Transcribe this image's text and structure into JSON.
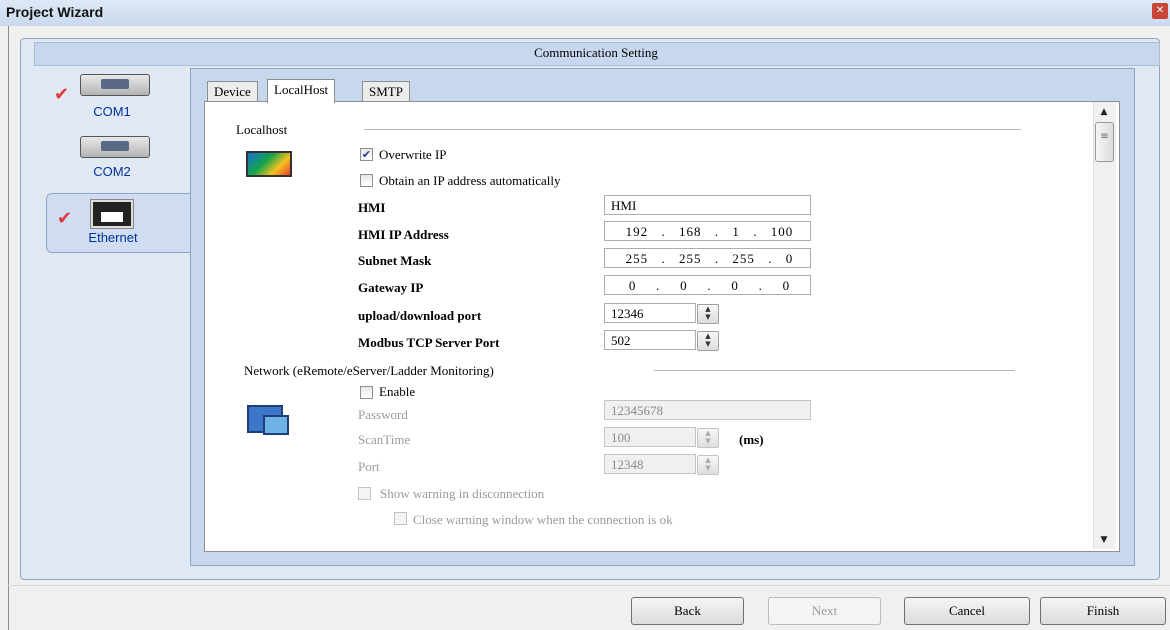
{
  "window": {
    "title": "Project Wizard",
    "close_glyph": "✕"
  },
  "dialog": {
    "header": "Communication Setting"
  },
  "nav": {
    "items": [
      {
        "label": "COM1",
        "checked": true,
        "selected": false,
        "icon": "serial-port-icon"
      },
      {
        "label": "COM2",
        "checked": false,
        "selected": false,
        "icon": "serial-port-icon"
      },
      {
        "label": "Ethernet",
        "checked": true,
        "selected": true,
        "icon": "ethernet-port-icon"
      }
    ],
    "check_glyph": "✔"
  },
  "tabs": [
    {
      "label": "Device",
      "active": false
    },
    {
      "label": "LocalHost",
      "active": true
    },
    {
      "label": "SMTP",
      "active": false
    }
  ],
  "localhost": {
    "section_title": "Localhost",
    "overwrite_ip": {
      "label": "Overwrite IP",
      "checked": true
    },
    "obtain_auto": {
      "label": "Obtain an IP address automatically",
      "checked": false
    },
    "hmi": {
      "label": "HMI",
      "value": "HMI"
    },
    "hmi_ip": {
      "label": "HMI IP Address",
      "octets": [
        "192",
        "168",
        "1",
        "100"
      ]
    },
    "subnet": {
      "label": "Subnet Mask",
      "octets": [
        "255",
        "255",
        "255",
        "0"
      ]
    },
    "gateway": {
      "label": "Gateway IP",
      "octets": [
        "0",
        "0",
        "0",
        "0"
      ]
    },
    "upload_port": {
      "label": "upload/download port",
      "value": "12346"
    },
    "modbus_port": {
      "label": "Modbus TCP Server Port",
      "value": "502"
    }
  },
  "network": {
    "section_title": "Network (eRemote/eServer/Ladder Monitoring)",
    "enable": {
      "label": "Enable",
      "checked": false
    },
    "password": {
      "label": "Password",
      "value": "12345678"
    },
    "scantime": {
      "label": "ScanTime",
      "value": "100",
      "unit": "(ms)"
    },
    "port": {
      "label": "Port",
      "value": "12348"
    },
    "show_warning": {
      "label": "Show warning in disconnection",
      "checked": false
    },
    "close_warning": {
      "label": "Close warning window when the connection is ok",
      "checked": false
    }
  },
  "ip_dot": ".",
  "glyphs": {
    "check": "✔",
    "up": "▲",
    "down": "▼",
    "spin": "▲\n▼",
    "grip": "≡"
  },
  "buttons": {
    "back": "Back",
    "next": "Next",
    "cancel": "Cancel",
    "finish": "Finish"
  },
  "colors": {
    "accent": "#003399",
    "check_red": "#e03a3a",
    "panel_blue": "#c7d8ee"
  }
}
